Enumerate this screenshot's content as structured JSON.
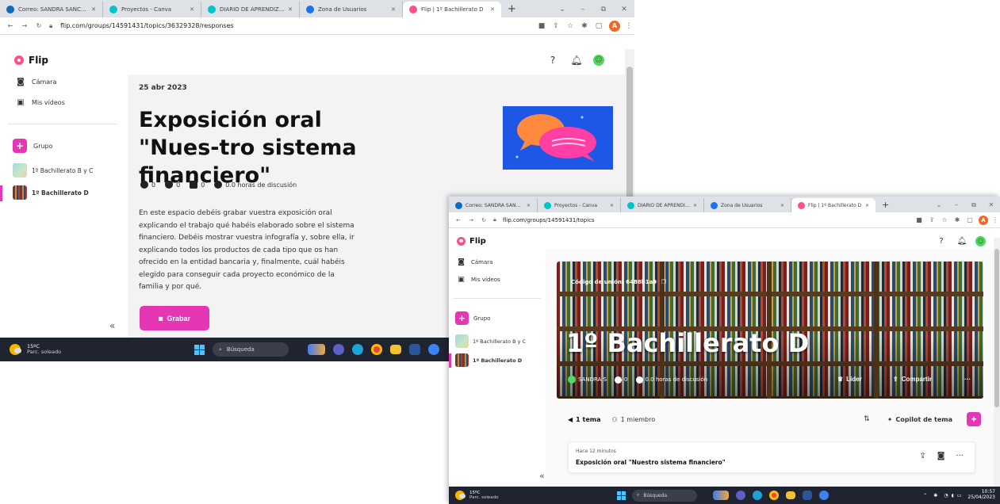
{
  "colors": {
    "accent": "#e436b5",
    "tabstrip": "#dee1e6",
    "taskbar": "#1f2430"
  },
  "window1": {
    "tabs": [
      {
        "label": "Correo: SANDRA SANCHE",
        "icon": "outlook-icon",
        "color": "#0f6cbd"
      },
      {
        "label": "Proyectos - Canva",
        "icon": "canva-icon",
        "color": "#00c4cc"
      },
      {
        "label": "DIARIO DE APRENDIZAJE",
        "icon": "canva-icon",
        "color": "#00c4cc"
      },
      {
        "label": "Zona de Usuarios",
        "icon": "user-zone-icon",
        "color": "#1a73e8"
      },
      {
        "label": "Flip | 1º Bachillerato D",
        "icon": "flip-icon",
        "color": "#ff4f8b"
      }
    ],
    "url": "flip.com/groups/14591431/topics/36329328/responses",
    "app_name": "Flip",
    "sidebar": {
      "camera": "Cámara",
      "my_videos": "Mis vídeos",
      "group": "Grupo",
      "groups": [
        "1º Bachillerato B y C",
        "1º Bachillerato D"
      ]
    },
    "post": {
      "date": "25 abr 2023",
      "title": "Exposición oral \"Nues-tro sistema financiero\"",
      "stats": {
        "videos": "0",
        "views": "0",
        "comments": "0",
        "discussion": "0.0 horas de discusión"
      },
      "body": "En este espacio debéis grabar vuestra exposición oral explicando el trabajo qué habéis elaborado sobre el sistema financiero. Debéis mostrar vuestra infografía y, sobre ella, ir explicando todos los productos de cada tipo que os han ofrecido en la entidad bancaria y, finalmente, cuál habéis elegido para conseguir cada proyecto económico de la familia y por qué.",
      "record_label": "Grabar"
    },
    "taskbar": {
      "temp": "15ºC",
      "weather": "Parc. soleado",
      "search": "Búsqueda"
    }
  },
  "window2": {
    "tabs": [
      {
        "label": "Correo: SANDRA SANCHE",
        "icon": "outlook-icon",
        "color": "#0f6cbd"
      },
      {
        "label": "Proyectos - Canva",
        "icon": "canva-icon",
        "color": "#00c4cc"
      },
      {
        "label": "DIARIO DE APRENDIZAJE",
        "icon": "canva-icon",
        "color": "#00c4cc"
      },
      {
        "label": "Zona de Usuarios",
        "icon": "user-zone-icon",
        "color": "#1a73e8"
      },
      {
        "label": "Flip | 1º Bachillerato D",
        "icon": "flip-icon",
        "color": "#ff4f8b"
      }
    ],
    "url": "flip.com/groups/14591431/topics",
    "app_name": "Flip",
    "sidebar": {
      "camera": "Cámara",
      "my_videos": "Mis vídeos",
      "group": "Grupo",
      "groups": [
        "1º Bachillerato B y C",
        "1º Bachillerato D"
      ]
    },
    "group": {
      "join_code": "Código de unión: 6488b1a9",
      "title": "1º Bachillerato D",
      "owner": "SANDRA S",
      "videos": "0",
      "discussion": "0.0 horas de discusión",
      "leader_label": "Líder",
      "share_label": "Compartir"
    },
    "tabs_bar": {
      "topics": "1 tema",
      "members": "1 miembro",
      "copilot": "Copilot de tema"
    },
    "topic": {
      "time": "Hace 12 minutos",
      "title": "Exposición oral \"Nuestro sistema financiero\""
    },
    "taskbar": {
      "temp": "15ºC",
      "weather": "Parc. soleado",
      "search": "Búsqueda",
      "time": "10:57",
      "date": "25/04/2023"
    }
  }
}
